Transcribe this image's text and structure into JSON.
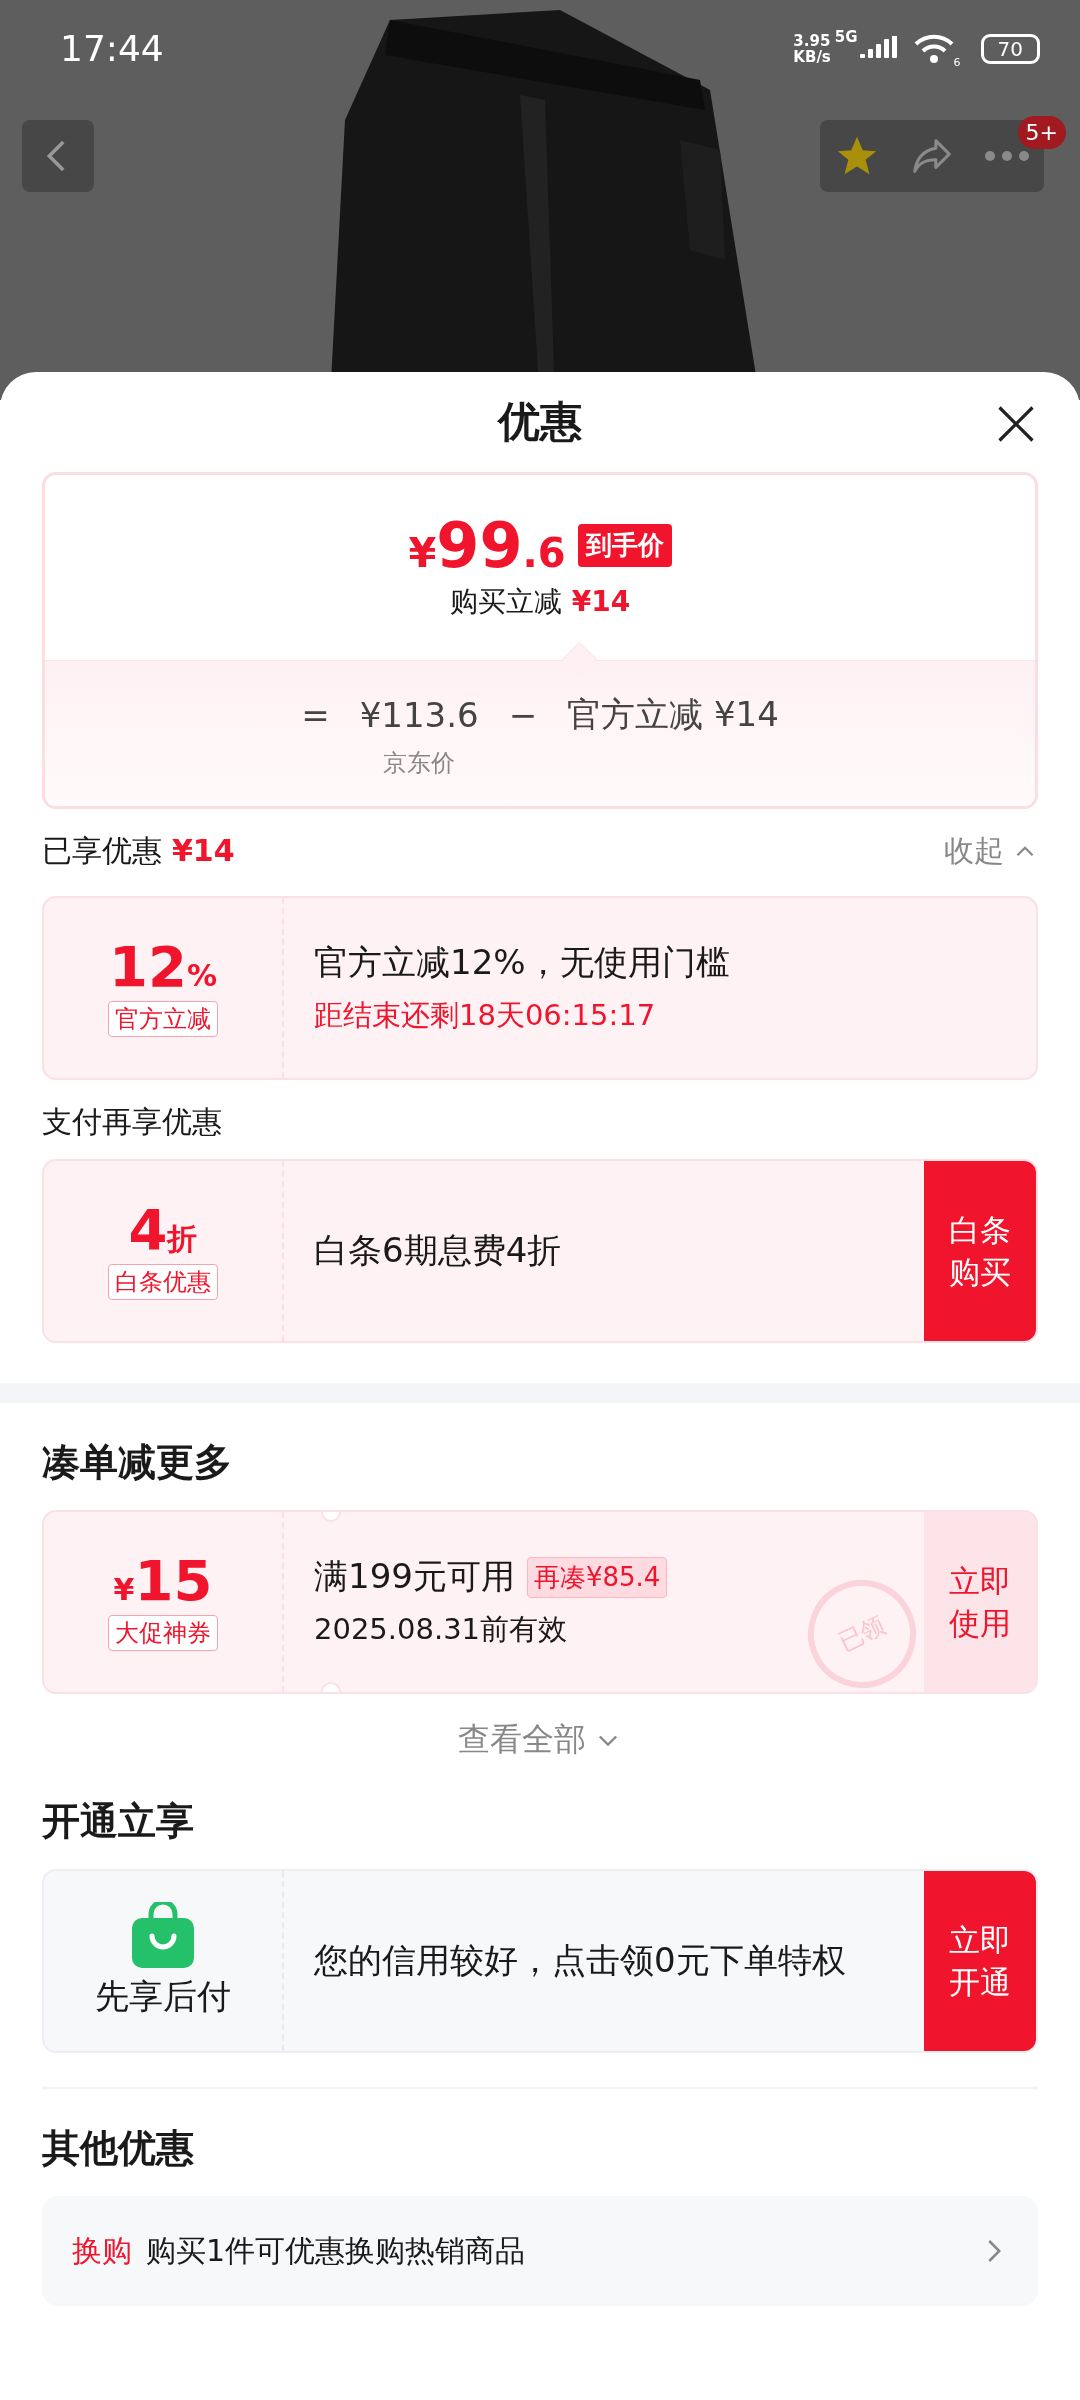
{
  "status_bar": {
    "time": "17:44",
    "speed_value": "3.95",
    "speed_unit": "KB/s",
    "network": "5G",
    "wifi_label": "6",
    "battery": "70"
  },
  "header": {
    "badge": "5+"
  },
  "sheet": {
    "title": "优惠"
  },
  "price_card": {
    "currency": "¥",
    "price_int": "99",
    "price_dec": ".6",
    "price_tag": "到手价",
    "subtitle": "购买立减",
    "subtitle_amount": "¥14",
    "equals": "=",
    "base_price": "¥113.6",
    "minus": "−",
    "discount": "官方立减 ¥14",
    "base_label": "京东价"
  },
  "enjoyed": {
    "label": "已享优惠",
    "amount": "¥14",
    "toggle": "收起",
    "expanded": true
  },
  "sections": [
    {
      "cards": [
        {
          "kind": "coupon",
          "value": "12",
          "unit": "%",
          "tag": "官方立减",
          "title": "官方立减12%，无使用门槛",
          "countdown": "距结束还剩18天06:15:17"
        }
      ]
    },
    {
      "caption": "支付再享优惠",
      "cards": [
        {
          "kind": "coupon",
          "value": "4",
          "unit": "折",
          "tag": "白条优惠",
          "title": "白条6期息费4折",
          "action": "白条购买",
          "emphasized": true
        }
      ]
    },
    {
      "title": "凑单减更多",
      "divider_before": true,
      "cards": [
        {
          "kind": "coupon",
          "prefix": "¥",
          "value": "15",
          "tag": "大促神券",
          "title": "满199元可用",
          "chip": "再凑¥85.4",
          "validity": "2025.08.31前有效",
          "action": "立即使用",
          "emphasized": false,
          "stamp": "已领"
        }
      ],
      "more_link": "查看全部"
    },
    {
      "title": "开通立享",
      "cards": [
        {
          "kind": "credit",
          "label": "先享后付",
          "title": "您的信用较好，点击领0元下单特权",
          "action": "立即开通",
          "emphasized": true
        }
      ]
    }
  ],
  "other_offers": {
    "title": "其他优惠",
    "items": [
      {
        "tag": "换购",
        "text": "购买1件可优惠换购热销商品"
      }
    ]
  }
}
